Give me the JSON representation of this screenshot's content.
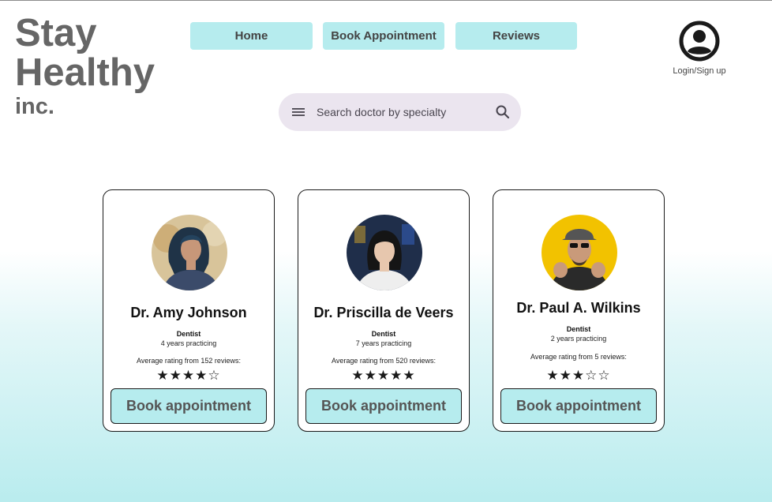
{
  "brand": {
    "line1": "Stay",
    "line2": "Healthy",
    "line3": "inc."
  },
  "nav": {
    "home": "Home",
    "book": "Book Appointment",
    "reviews": "Reviews"
  },
  "login": {
    "label": "Login/Sign up",
    "icon": "account-circle-icon"
  },
  "search": {
    "placeholder": "Search doctor by specialty",
    "value": "",
    "menu_icon": "menu-icon",
    "search_icon": "search-icon"
  },
  "doctors": [
    {
      "name": "Dr. Amy Johnson",
      "specialty": "Dentist",
      "years": "4 years practicing",
      "rating_label": "Average rating from 152 reviews:",
      "rating": 4,
      "stars": "★★★★☆",
      "button": "Book appointment"
    },
    {
      "name": "Dr. Priscilla de Veers",
      "specialty": "Dentist",
      "years": "7 years practicing",
      "rating_label": "Average rating from 520 reviews:",
      "rating": 5,
      "stars": "★★★★★",
      "button": "Book appointment"
    },
    {
      "name": "Dr. Paul A. Wilkins",
      "specialty": "Dentist",
      "years": "2 years practicing",
      "rating_label": "Average rating from 5 reviews:",
      "rating": 3,
      "stars": "★★★☆☆",
      "button": "Book appointment"
    }
  ],
  "colors": {
    "accent": "#b6ecee",
    "search_bg": "#ebe5ef",
    "logo": "#666666"
  }
}
